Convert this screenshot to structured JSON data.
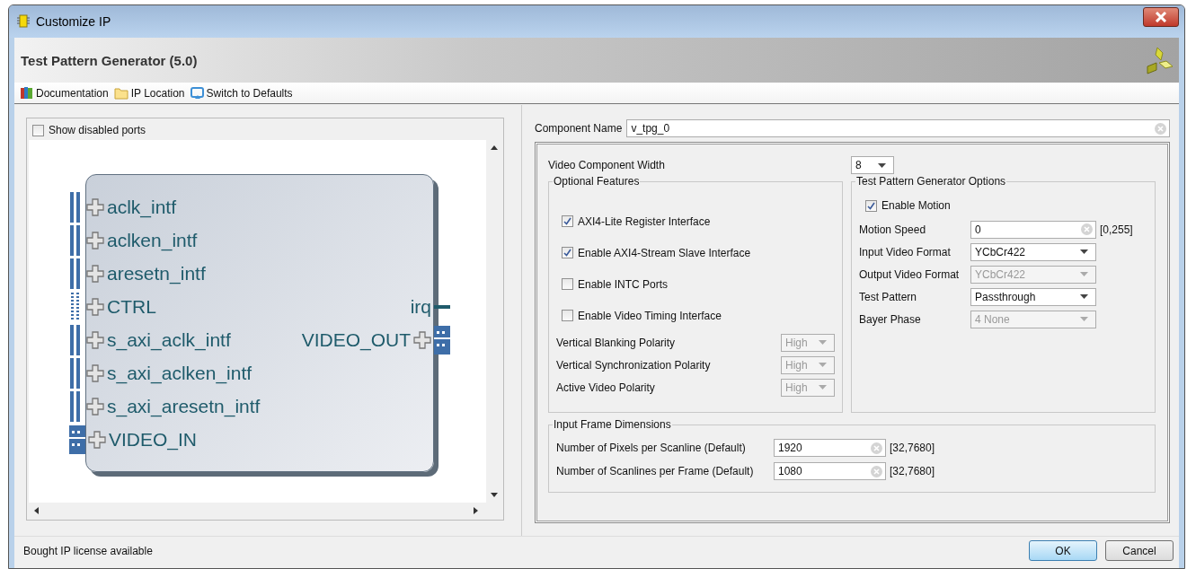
{
  "window": {
    "title": "Customize IP"
  },
  "header": {
    "title": "Test Pattern Generator (5.0)"
  },
  "toolbar": [
    {
      "kind": "docs",
      "label": "Documentation"
    },
    {
      "kind": "folder",
      "label": "IP Location"
    },
    {
      "kind": "reset",
      "label": "Switch to Defaults"
    }
  ],
  "show_disabled_ports": {
    "label": "Show disabled ports",
    "checked": false
  },
  "block": {
    "left_ports": [
      {
        "name": "aclk_intf",
        "kind": "bus"
      },
      {
        "name": "aclken_intf",
        "kind": "bus"
      },
      {
        "name": "aresetn_intf",
        "kind": "bus"
      },
      {
        "name": "CTRL",
        "kind": "dotted"
      },
      {
        "name": "s_axi_aclk_intf",
        "kind": "bus"
      },
      {
        "name": "s_axi_aclken_intf",
        "kind": "bus"
      },
      {
        "name": "s_axi_aresetn_intf",
        "kind": "bus"
      },
      {
        "name": "VIDEO_IN",
        "kind": "stream"
      }
    ],
    "right_ports": [
      {
        "name": "irq",
        "kind": "wire"
      },
      {
        "name": "VIDEO_OUT",
        "kind": "stream"
      }
    ]
  },
  "component_name": {
    "label": "Component Name",
    "value": "v_tpg_0"
  },
  "video_component_width": {
    "label": "Video Component Width",
    "value": "8"
  },
  "optional_features": {
    "title": "Optional Features",
    "checkboxes": [
      {
        "label": "AXI4-Lite Register Interface",
        "checked": true
      },
      {
        "label": "Enable AXI4-Stream Slave Interface",
        "checked": true
      },
      {
        "label": "Enable INTC Ports",
        "checked": false
      },
      {
        "label": "Enable Video Timing Interface",
        "checked": false
      }
    ],
    "selects": [
      {
        "label": "Vertical Blanking Polarity",
        "value": "High",
        "disabled": true
      },
      {
        "label": "Vertical Synchronization Polarity",
        "value": "High",
        "disabled": true
      },
      {
        "label": "Active Video Polarity",
        "value": "High",
        "disabled": true
      }
    ]
  },
  "tpg_options": {
    "title": "Test Pattern Generator Options",
    "enable_motion": {
      "label": "Enable Motion",
      "checked": true
    },
    "rows": [
      {
        "kind": "input",
        "label": "Motion Speed",
        "value": "0",
        "range": "[0,255]"
      },
      {
        "kind": "select",
        "label": "Input Video Format",
        "value": "YCbCr422",
        "disabled": false
      },
      {
        "kind": "select",
        "label": "Output Video Format",
        "value": "YCbCr422",
        "disabled": true
      },
      {
        "kind": "select",
        "label": "Test Pattern",
        "value": "Passthrough",
        "disabled": false
      },
      {
        "kind": "select",
        "label": "Bayer Phase",
        "value": "4 None",
        "disabled": true
      }
    ]
  },
  "frame_dimensions": {
    "title": "Input Frame Dimensions",
    "rows": [
      {
        "label": "Number of Pixels per Scanline (Default)",
        "value": "1920",
        "range": "[32,7680]"
      },
      {
        "label": "Number of Scanlines per Frame (Default)",
        "value": "1080",
        "range": "[32,7680]"
      }
    ]
  },
  "status": "Bought IP license available",
  "buttons": [
    {
      "label": "OK",
      "default": true
    },
    {
      "label": "Cancel",
      "default": false
    }
  ]
}
